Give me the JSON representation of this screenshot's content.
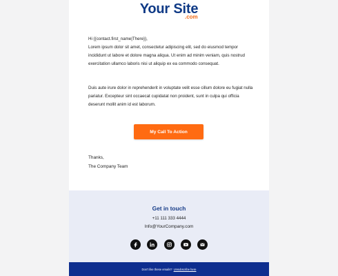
{
  "logo": {
    "main": "Your Site",
    "tld": ".com"
  },
  "message": {
    "greeting": "Hi {{contact.first_name|There}},",
    "paragraph1": "Lorem ipsum dolor sit amet, consectetur adipiscing elit, sed do eiusmod tempor incididunt ut labore et dolore magna aliqua. Ut enim ad minim veniam, quis nostrud exercitation ullamco laboris nisi ut aliquip ex ea commodo consequat.",
    "paragraph2": "Duis aute irure dolor in reprehenderit in voluptate velit esse cillum dolore eu fugiat nulla pariatur. Excepteur sint occaecat cupidatat non proident, sunt in culpa qui officia deserunt mollit anim id est laborum.",
    "cta_label": "My Call To Action",
    "signoff_thanks": "Thanks,",
    "signoff_team": "The Company Team"
  },
  "footer": {
    "title": "Get in touch",
    "phone": "+11 111 333 4444",
    "email": "Info@YourCompany.com",
    "socials": [
      {
        "name": "facebook",
        "icon": "facebook-icon"
      },
      {
        "name": "linkedin",
        "icon": "linkedin-icon"
      },
      {
        "name": "instagram",
        "icon": "instagram-icon"
      },
      {
        "name": "youtube",
        "icon": "youtube-icon"
      },
      {
        "name": "email",
        "icon": "email-icon"
      }
    ],
    "unsubscribe_prompt": "Don't like these emails?",
    "unsubscribe_link": "Unsubscribe here"
  },
  "colors": {
    "brand_blue": "#0f3a86",
    "accent_orange": "#ff6b12",
    "footer_bg": "#e9ecf6",
    "bottom_bar": "#0e2e8f"
  }
}
